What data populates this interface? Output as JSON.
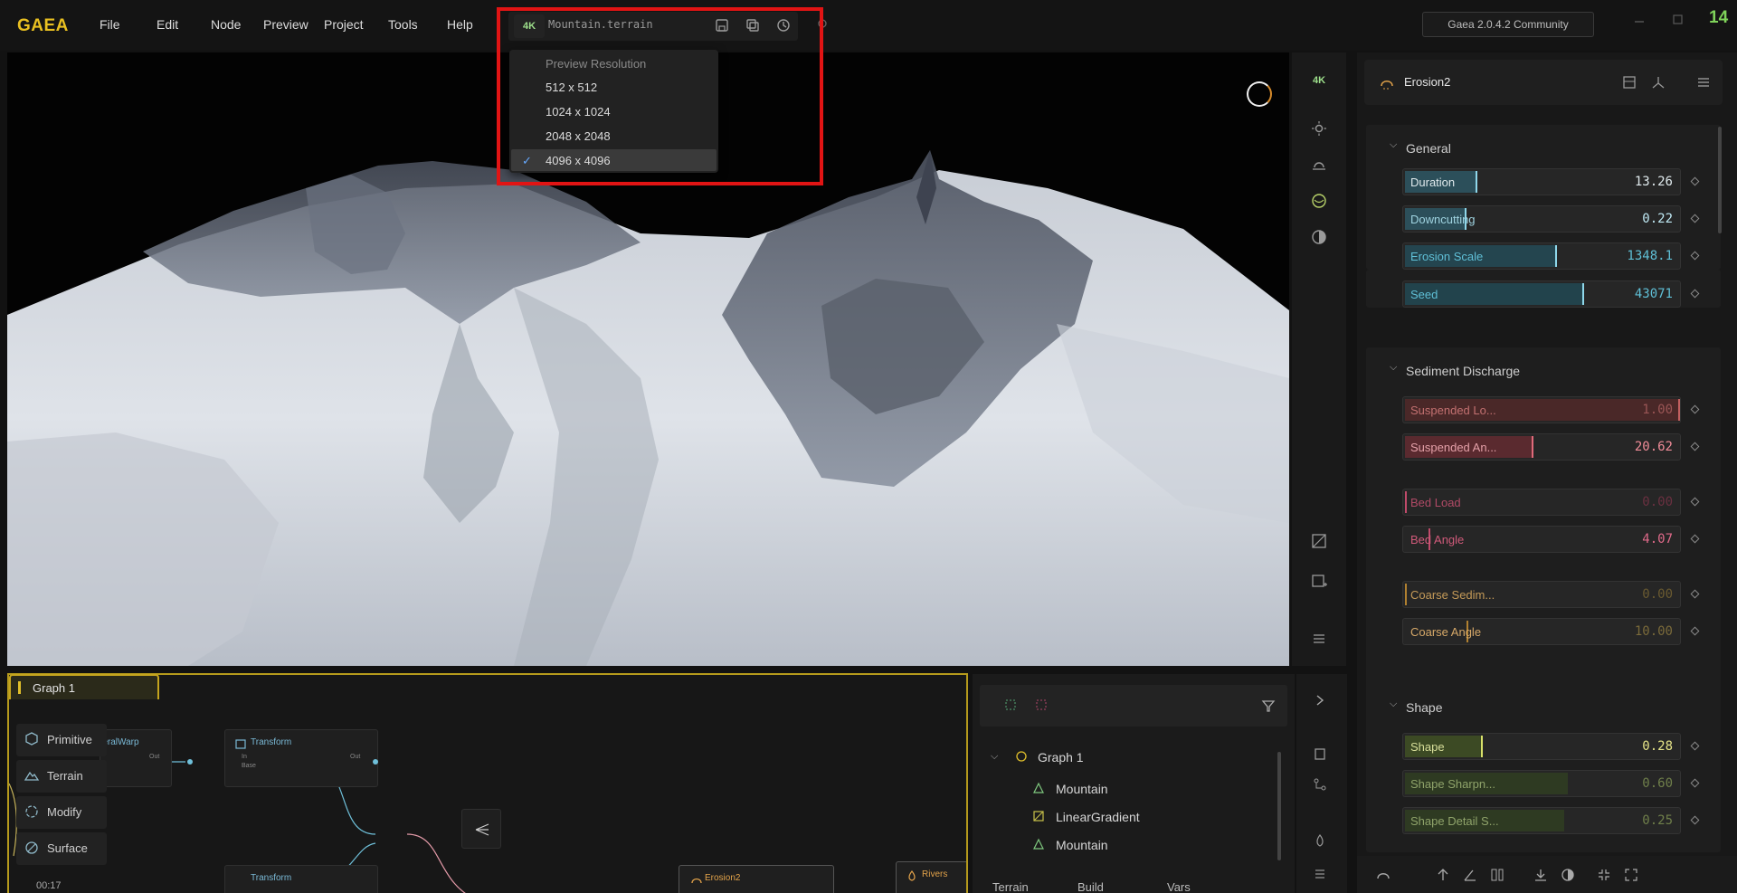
{
  "menubar": {
    "logo": "GAEA",
    "items": [
      "File",
      "Edit",
      "Node",
      "Preview",
      "Project",
      "Tools",
      "Help"
    ],
    "resolution_badge": "4K",
    "filename": "Mountain.terrain",
    "version": "Gaea 2.0.4.2 Community",
    "corner_number": "14"
  },
  "resolution_menu": {
    "header": "Preview Resolution",
    "options": [
      "512 x 512",
      "1024 x 1024",
      "2048 x 2048",
      "4096 x 4096"
    ],
    "selected": "4096 x 4096"
  },
  "viewport_toolbar": {
    "resolution_badge": "4K"
  },
  "graph": {
    "tab": "Graph 1",
    "sidebar": [
      "Primitive",
      "Terrain",
      "Modify",
      "Surface"
    ],
    "time": "00:17",
    "nodes": [
      {
        "title": "...eralWarp",
        "out": "Out"
      },
      {
        "title": "Transform",
        "in": "In",
        "base": "Base",
        "out": "Out"
      },
      {
        "title": "Transform"
      },
      {
        "title": "Erosion2"
      },
      {
        "title": "Rivers"
      }
    ]
  },
  "layers": {
    "root": "Graph 1",
    "items": [
      "Mountain",
      "LinearGradient",
      "Mountain"
    ],
    "tabs": [
      "Terrain",
      "Build",
      "Vars"
    ]
  },
  "properties": {
    "node_name": "Erosion2",
    "sections": [
      {
        "title": "General",
        "params": [
          {
            "label": "Duration",
            "value": "13.26"
          },
          {
            "label": "Downcutting",
            "value": "0.22"
          },
          {
            "label": "Erosion Scale",
            "value": "1348.1"
          },
          {
            "label": "Seed",
            "value": "43071"
          }
        ]
      },
      {
        "title": "Sediment Discharge",
        "params": [
          {
            "label": "Suspended Lo...",
            "value": "1.00"
          },
          {
            "label": "Suspended An...",
            "value": "20.62"
          },
          {
            "label": "Bed Load",
            "value": "0.00"
          },
          {
            "label": "Bed Angle",
            "value": "4.07"
          },
          {
            "label": "Coarse Sedim...",
            "value": "0.00"
          },
          {
            "label": "Coarse Angle",
            "value": "10.00"
          }
        ]
      },
      {
        "title": "Shape",
        "params": [
          {
            "label": "Shape",
            "value": "0.28"
          },
          {
            "label": "Shape Sharpn...",
            "value": "0.60"
          },
          {
            "label": "Shape Detail S...",
            "value": "0.25"
          }
        ]
      }
    ]
  },
  "colors": {
    "accent": "#e9c021",
    "highlight": "#e11414",
    "general": "#2f5560",
    "sediment_red": "#5a2a2a",
    "bed_pink": "#c04a6a",
    "coarse": "#b08030",
    "shape_green": "#3c4a2a"
  }
}
